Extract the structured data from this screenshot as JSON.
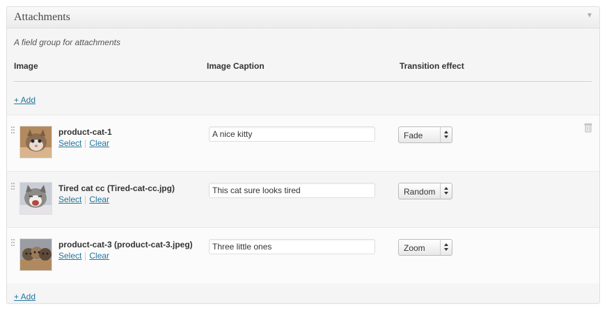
{
  "metabox": {
    "title": "Attachments",
    "description": "A field group for attachments"
  },
  "columns": {
    "image": "Image",
    "caption": "Image Caption",
    "transition": "Transition effect"
  },
  "add_label": "+ Add",
  "select_label": "Select",
  "clear_label": "Clear",
  "rows": [
    {
      "name": "product-cat-1",
      "caption": "A nice kitty",
      "transition": "Fade"
    },
    {
      "name": "Tired cat cc (Tired-cat-cc.jpg)",
      "caption": "This cat sure looks tired",
      "transition": "Random"
    },
    {
      "name": "product-cat-3 (product-cat-3.jpeg)",
      "caption": "Three little ones",
      "transition": "Zoom"
    }
  ],
  "colors": {
    "link": "#21759b",
    "panel_bg": "#f5f5f5",
    "border": "#dfdfdf"
  },
  "icons": [
    "collapse-toggle-icon",
    "drag-handle-icon",
    "trash-icon",
    "select-arrows-icon"
  ]
}
